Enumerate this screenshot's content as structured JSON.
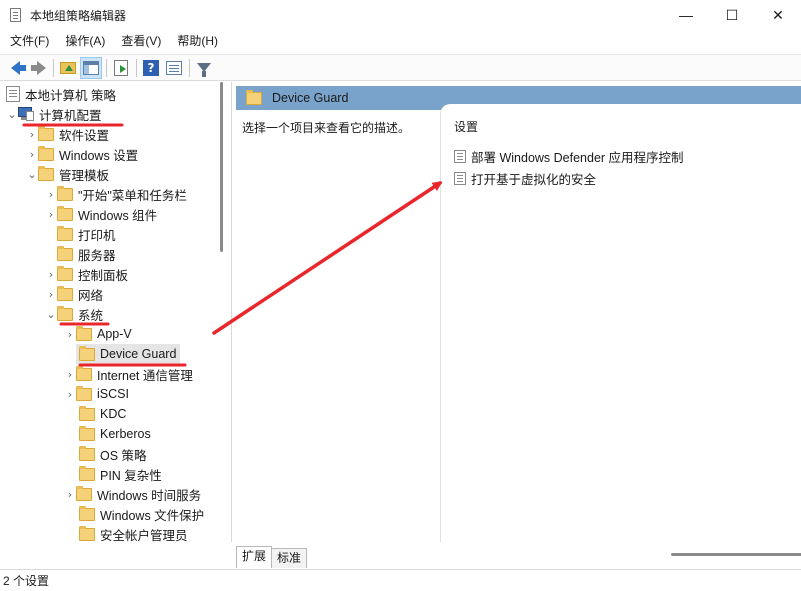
{
  "window": {
    "title": "本地组策略编辑器",
    "controls": {
      "minimize": "—",
      "maximize": "☐",
      "close": "✕"
    }
  },
  "menu": [
    "文件(F)",
    "操作(A)",
    "查看(V)",
    "帮助(H)"
  ],
  "toolbar": {
    "icons": [
      "back-arrow-icon",
      "forward-arrow-icon",
      "up-folder-icon",
      "show-hide-tree-icon",
      "export-list-icon",
      "help-icon",
      "properties-icon",
      "filter-icon"
    ]
  },
  "tree": {
    "root": "本地计算机 策略",
    "computer_config": "计算机配置",
    "items": {
      "software": "软件设置",
      "windows_settings": "Windows 设置",
      "admin_templates": "管理模板",
      "start_menu": "\"开始\"菜单和任务栏",
      "windows_components": "Windows 组件",
      "printers": "打印机",
      "servers": "服务器",
      "control_panel": "控制面板",
      "network": "网络",
      "system": "系统",
      "appv": "App-V",
      "device_guard": "Device Guard",
      "internet_comm": "Internet 通信管理",
      "iscsi": "iSCSI",
      "kdc": "KDC",
      "kerberos": "Kerberos",
      "os_policy": "OS 策略",
      "pin_complexity": "PIN 复杂性",
      "windows_time": "Windows 时间服务",
      "windows_file_protection": "Windows 文件保护",
      "security_account_manager": "安全帐户管理员"
    }
  },
  "right_pane": {
    "header": "Device Guard",
    "description_hint": "选择一个项目来查看它的描述。",
    "list_header": "设置",
    "settings": [
      "部署 Windows Defender 应用程序控制",
      "打开基于虚拟化的安全"
    ]
  },
  "tabs": [
    "扩展",
    "标准"
  ],
  "active_tab": "扩展",
  "status": "2 个设置",
  "colors": {
    "annotation_red": "#e8262c",
    "pane_header_blue": "#7aa3cb",
    "folder_yellow": "#f5d27a"
  }
}
